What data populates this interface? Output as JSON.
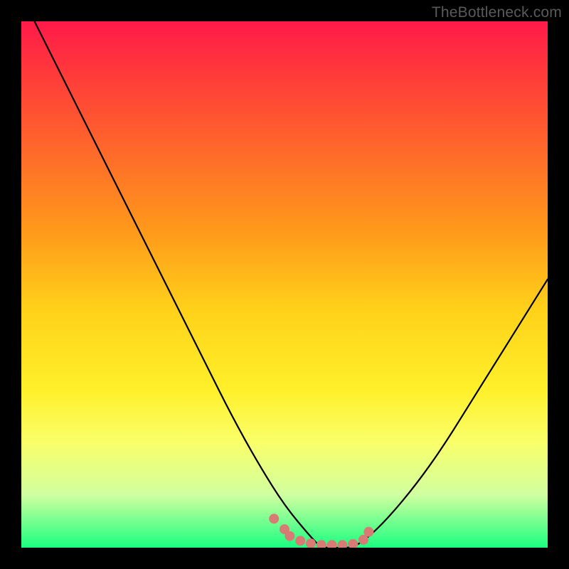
{
  "attribution": "TheBottleneck.com",
  "chart_data": {
    "type": "line",
    "title": "",
    "xlabel": "",
    "ylabel": "",
    "xlim": [
      0,
      100
    ],
    "ylim": [
      0,
      100
    ],
    "x": [
      0,
      5,
      10,
      15,
      20,
      25,
      30,
      35,
      40,
      45,
      50,
      55,
      57,
      60,
      63,
      66,
      70,
      75,
      80,
      85,
      90,
      95,
      100
    ],
    "values": [
      105,
      95,
      85,
      75,
      65,
      55,
      45,
      35,
      25,
      16,
      8,
      2,
      0,
      0,
      0,
      2,
      6,
      12,
      19,
      27,
      35,
      43,
      51
    ],
    "description": "V-shaped bottleneck curve reaching minimum of 0 around x≈57–63, left arm descends from above chart top, right arm ascends to mid-height",
    "markers": {
      "x": [
        48,
        50,
        51,
        53,
        55,
        57,
        59,
        61,
        63,
        65,
        66
      ],
      "values": [
        5.5,
        3.5,
        2.2,
        1.3,
        0.8,
        0.5,
        0.5,
        0.5,
        0.7,
        1.5,
        3.0
      ],
      "color": "#d87b75"
    },
    "colors": {
      "line": "#000000",
      "marker": "#d87b75",
      "gradient_top": "#ff1a4a",
      "gradient_bottom": "#1aff80"
    }
  }
}
